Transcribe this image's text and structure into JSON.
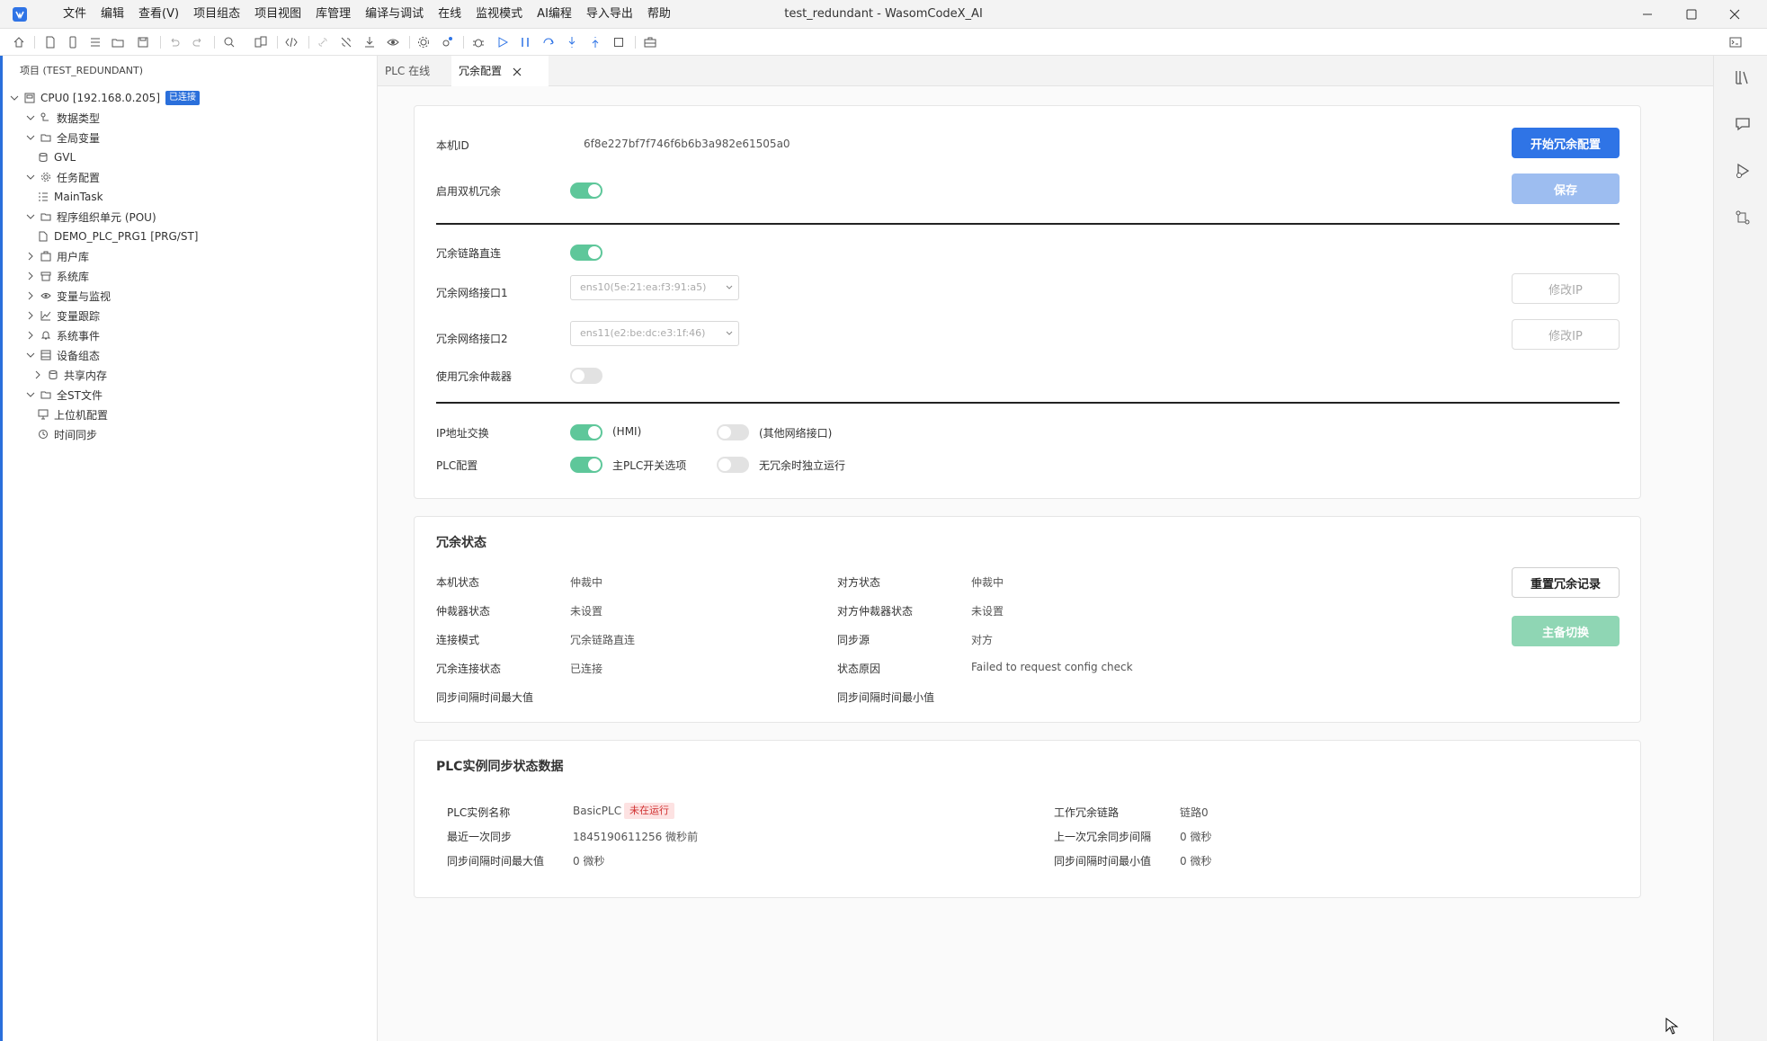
{
  "window": {
    "title": "test_redundant - WasomCodeX_AI",
    "menus": [
      "文件",
      "编辑",
      "查看(V)",
      "项目组态",
      "项目视图",
      "库管理",
      "编译与调试",
      "在线",
      "监视模式",
      "AI编程",
      "导入导出",
      "帮助"
    ]
  },
  "sidebar": {
    "header": "项目 (TEST_REDUNDANT)",
    "items": [
      {
        "label": "CPU0 [192.168.0.205]",
        "icon": "cpu-icon",
        "badge": "已连接"
      },
      {
        "label": "数据类型",
        "icon": "datatype-icon"
      },
      {
        "label": "全局变量",
        "icon": "folder-icon"
      },
      {
        "label": "GVL",
        "icon": "database-icon"
      },
      {
        "label": "任务配置",
        "icon": "gear-icon"
      },
      {
        "label": "MainTask",
        "icon": "task-list-icon"
      },
      {
        "label": "程序组织单元 (POU)",
        "icon": "folder-icon"
      },
      {
        "label": "DEMO_PLC_PRG1 [PRG/ST]",
        "icon": "file-icon"
      },
      {
        "label": "用户库",
        "icon": "library-icon"
      },
      {
        "label": "系统库",
        "icon": "archive-icon"
      },
      {
        "label": "变量与监视",
        "icon": "eye-icon"
      },
      {
        "label": "变量跟踪",
        "icon": "chart-line-icon"
      },
      {
        "label": "系统事件",
        "icon": "bell-icon"
      },
      {
        "label": "设备组态",
        "icon": "device-icon"
      },
      {
        "label": "共享内存",
        "icon": "database-icon"
      },
      {
        "label": "全ST文件",
        "icon": "folder-icon"
      },
      {
        "label": "上位机配置",
        "icon": "monitor-icon"
      },
      {
        "label": "时间同步",
        "icon": "clock-icon"
      }
    ]
  },
  "tabs": [
    {
      "label": "PLC 在线",
      "active": false
    },
    {
      "label": "冗余配置",
      "active": true
    }
  ],
  "config": {
    "local_id_label": "本机ID",
    "local_id_value": "6f8e227bf7f746f6b6b3a982e61505a0",
    "enable_dual_label": "启用双机冗余",
    "enable_dual_on": true,
    "start_button": "开始冗余配置",
    "save_button": "保存",
    "link_direct_label": "冗余链路直连",
    "link_direct_on": true,
    "iface1_label": "冗余网络接口1",
    "iface1_value": "ens10(5e:21:ea:f3:91:a5)",
    "iface2_label": "冗余网络接口2",
    "iface2_value": "ens11(e2:be:dc:e3:1f:46)",
    "modify_ip_1": "修改IP",
    "modify_ip_2": "修改IP",
    "arbiter_label": "使用冗余仲裁器",
    "arbiter_on": false,
    "ip_swap_label": "IP地址交换",
    "ip_swap_hmi_on": true,
    "ip_swap_hmi_text": "(HMI)",
    "ip_swap_other_on": false,
    "ip_swap_other_text": "(其他网络接口)",
    "plc_config_label": "PLC配置",
    "plc_master_on": true,
    "plc_master_text": "主PLC开关选项",
    "plc_standalone_on": false,
    "plc_standalone_text": "无冗余时独立运行"
  },
  "status": {
    "title": "冗余状态",
    "left": [
      {
        "label": "本机状态",
        "value": "仲裁中"
      },
      {
        "label": "仲裁器状态",
        "value": "未设置"
      },
      {
        "label": "连接模式",
        "value": "冗余链路直连"
      },
      {
        "label": "冗余连接状态",
        "value": "已连接"
      },
      {
        "label": "同步间隔时间最大值",
        "value": ""
      }
    ],
    "right": [
      {
        "label": "对方状态",
        "value": "仲裁中"
      },
      {
        "label": "对方仲裁器状态",
        "value": "未设置"
      },
      {
        "label": "同步源",
        "value": "对方"
      },
      {
        "label": "状态原因",
        "value": "Failed to request config check"
      },
      {
        "label": "同步间隔时间最小值",
        "value": ""
      }
    ],
    "reset_button": "重置冗余记录",
    "switch_button": "主备切换"
  },
  "sync": {
    "title": "PLC实例同步状态数据",
    "instance_label": "PLC实例名称",
    "instance_value": "BasicPLC",
    "instance_tag": "未在运行",
    "last_sync_label": "最近一次同步",
    "last_sync_value": "1845190611256 微秒前",
    "max_label": "同步间隔时间最大值",
    "max_value": "0 微秒",
    "link_label": "工作冗余链路",
    "link_value": "链路0",
    "prev_label": "上一次冗余同步间隔",
    "prev_value": "0 微秒",
    "min_label": "同步间隔时间最小值",
    "min_value": "0 微秒"
  },
  "colors": {
    "accent": "#2f74e6",
    "toggle_on": "#5ec79a",
    "danger_tag_bg": "#fde2e2"
  }
}
